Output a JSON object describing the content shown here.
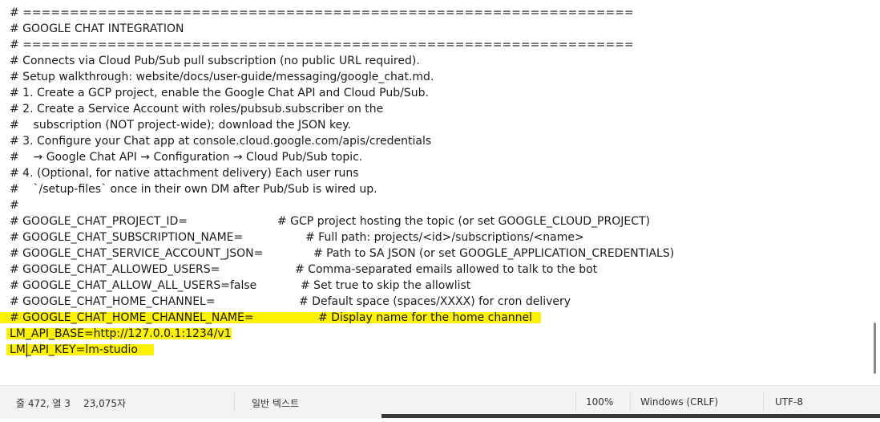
{
  "editor": {
    "lines": [
      "# =================================================================",
      "# GOOGLE CHAT INTEGRATION",
      "# =================================================================",
      "# Connects via Cloud Pub/Sub pull subscription (no public URL required).",
      "# Setup walkthrough: website/docs/user-guide/messaging/google_chat.md.",
      "# 1. Create a GCP project, enable the Google Chat API and Cloud Pub/Sub.",
      "# 2. Create a Service Account with roles/pubsub.subscriber on the",
      "#    subscription (NOT project-wide); download the JSON key.",
      "# 3. Configure your Chat app at console.cloud.google.com/apis/credentials",
      "#    → Google Chat API → Configuration → Cloud Pub/Sub topic.",
      "# 4. (Optional, for native attachment delivery) Each user runs",
      "#    `/setup-files` once in their own DM after Pub/Sub is wired up.",
      "#"
    ],
    "config_lines": [
      {
        "key": "# GOOGLE_CHAT_PROJECT_ID=",
        "comment": "# GCP project hosting the topic (or set GOOGLE_CLOUD_PROJECT)"
      },
      {
        "key": "# GOOGLE_CHAT_SUBSCRIPTION_NAME=",
        "comment": "# Full path: projects/<id>/subscriptions/<name>"
      },
      {
        "key": "# GOOGLE_CHAT_SERVICE_ACCOUNT_JSON=",
        "comment": "# Path to SA JSON (or set GOOGLE_APPLICATION_CREDENTIALS)"
      },
      {
        "key": "# GOOGLE_CHAT_ALLOWED_USERS=",
        "comment": "# Comma-separated emails allowed to talk to the bot"
      },
      {
        "key": "# GOOGLE_CHAT_ALLOW_ALL_USERS=false",
        "comment": "# Set true to skip the allowlist"
      },
      {
        "key": "# GOOGLE_CHAT_HOME_CHANNEL=",
        "comment": "# Default space (spaces/XXXX) for cron delivery"
      },
      {
        "key": "# GOOGLE_CHAT_HOME_CHANNEL_NAME=",
        "comment": "# Display name for the home channel"
      }
    ],
    "tail_lines": [
      "LM_API_BASE=http://127.0.0.1:1234/v1",
      "LM_API_KEY=lm-studio"
    ],
    "highlight_color": "#fff200"
  },
  "status": {
    "position": "줄 472, 열 3",
    "char_count": "23,075자",
    "format": "일반 텍스트",
    "zoom": "100%",
    "line_ending": "Windows (CRLF)",
    "encoding": "UTF-8"
  }
}
